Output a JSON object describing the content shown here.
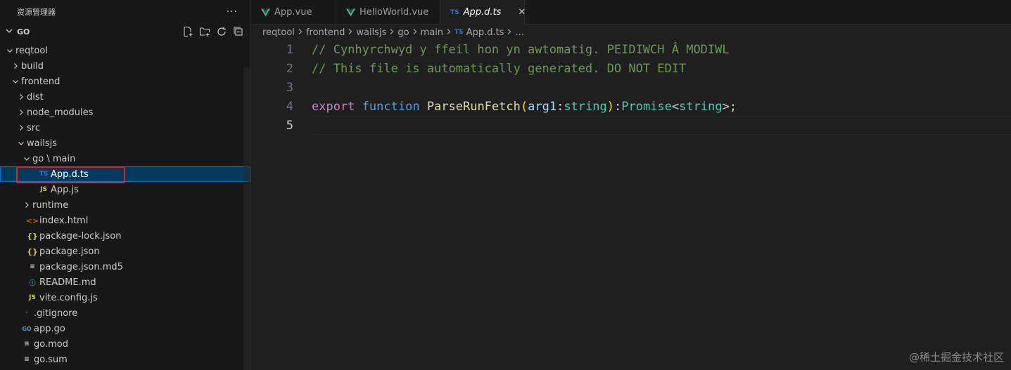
{
  "sidebar": {
    "title": "资源管理器",
    "more": "···",
    "section": "GO",
    "tree": [
      {
        "label": "reqtool",
        "depth": 1,
        "twisty": "down",
        "icon": ""
      },
      {
        "label": "build",
        "depth": 2,
        "twisty": "right",
        "icon": ""
      },
      {
        "label": "frontend",
        "depth": 2,
        "twisty": "down",
        "icon": ""
      },
      {
        "label": "dist",
        "depth": 3,
        "twisty": "right",
        "icon": ""
      },
      {
        "label": "node_modules",
        "depth": 3,
        "twisty": "right",
        "icon": ""
      },
      {
        "label": "src",
        "depth": 3,
        "twisty": "right",
        "icon": ""
      },
      {
        "label": "wailsjs",
        "depth": 3,
        "twisty": "down",
        "icon": ""
      },
      {
        "label": "go \\ main",
        "depth": 4,
        "twisty": "down",
        "icon": ""
      },
      {
        "label": "App.d.ts",
        "depth": 5,
        "twisty": "",
        "icon": "TS",
        "selected": true
      },
      {
        "label": "App.js",
        "depth": 5,
        "twisty": "",
        "icon": "JS"
      },
      {
        "label": "runtime",
        "depth": 4,
        "twisty": "right",
        "icon": ""
      },
      {
        "label": "index.html",
        "depth": 3,
        "twisty": "",
        "icon": "<>"
      },
      {
        "label": "package-lock.json",
        "depth": 3,
        "twisty": "",
        "icon": "{}"
      },
      {
        "label": "package.json",
        "depth": 3,
        "twisty": "",
        "icon": "{}"
      },
      {
        "label": "package.json.md5",
        "depth": 3,
        "twisty": "",
        "icon": "≡"
      },
      {
        "label": "README.md",
        "depth": 3,
        "twisty": "",
        "icon": "ⓘ"
      },
      {
        "label": "vite.config.js",
        "depth": 3,
        "twisty": "",
        "icon": "JS"
      },
      {
        "label": ".gitignore",
        "depth": 2,
        "twisty": "",
        "icon": "·"
      },
      {
        "label": "app.go",
        "depth": 2,
        "twisty": "",
        "icon": "GO"
      },
      {
        "label": "go.mod",
        "depth": 2,
        "twisty": "",
        "icon": "≡"
      },
      {
        "label": "go.sum",
        "depth": 2,
        "twisty": "",
        "icon": "≡"
      }
    ]
  },
  "tabs": [
    {
      "label": "App.vue",
      "icon": "vue"
    },
    {
      "label": "HelloWorld.vue",
      "icon": "vue"
    },
    {
      "label": "App.d.ts",
      "icon": "TS",
      "active": true,
      "close": "✕"
    }
  ],
  "breadcrumb": {
    "parts": [
      "reqtool",
      "frontend",
      "wailsjs",
      "go",
      "main"
    ],
    "file_icon": "TS",
    "file": "App.d.ts",
    "tail": "..."
  },
  "editor": {
    "line_numbers": [
      "1",
      "2",
      "3",
      "4",
      "5"
    ],
    "line1": "// Cynhyrchwyd y ffeil hon yn awtomatig. PEIDIWCH Â MODIWL",
    "line2": "// This file is automatically generated. DO NOT EDIT",
    "line4": {
      "kw": "export",
      "fnkw": "function",
      "name": "ParseRunFetch",
      "open": "(",
      "param": "arg1",
      "colon": ":",
      "ptype": "string",
      "close": ")",
      "colon2": ":",
      "rtype": "Promise",
      "lt": "<",
      "gtype": "string",
      "gt": ">",
      "semi": ";"
    }
  },
  "watermark": "@稀土掘金技术社区",
  "colors": {
    "accent": "#0078d4",
    "highlight": "#d9242a",
    "comment": "#6a9955",
    "keyword": "#c586c0",
    "function": "#dcdcaa",
    "type": "#4ec9b0"
  }
}
